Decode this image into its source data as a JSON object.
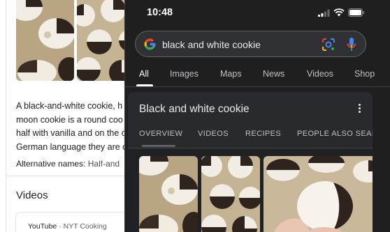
{
  "left_panel": {
    "description_lines": [
      "A black-and-white cookie, h",
      "moon cookie is a round coo",
      "half with vanilla and on the o",
      "German language they are c"
    ],
    "alternative_names_label": "Alternative names:",
    "alternative_names_value": "Half-and",
    "videos_heading": "Videos",
    "video_source": "YouTube",
    "video_separator": " · ",
    "video_channel": "NYT Cooking"
  },
  "status_bar": {
    "time": "10:48"
  },
  "search": {
    "query": "black and white cookie"
  },
  "tabs": [
    "All",
    "Images",
    "Maps",
    "News",
    "Videos",
    "Shop"
  ],
  "knowledge_panel": {
    "title": "Black and white cookie",
    "tabs": [
      "OVERVIEW",
      "VIDEOS",
      "RECIPES",
      "PEOPLE ALSO SEAR"
    ]
  },
  "colors": {
    "google_blue": "#4285f4",
    "google_red": "#ea4335",
    "google_yellow": "#fbbc05",
    "google_green": "#34a853",
    "dark_bg": "#1f1f1f"
  }
}
